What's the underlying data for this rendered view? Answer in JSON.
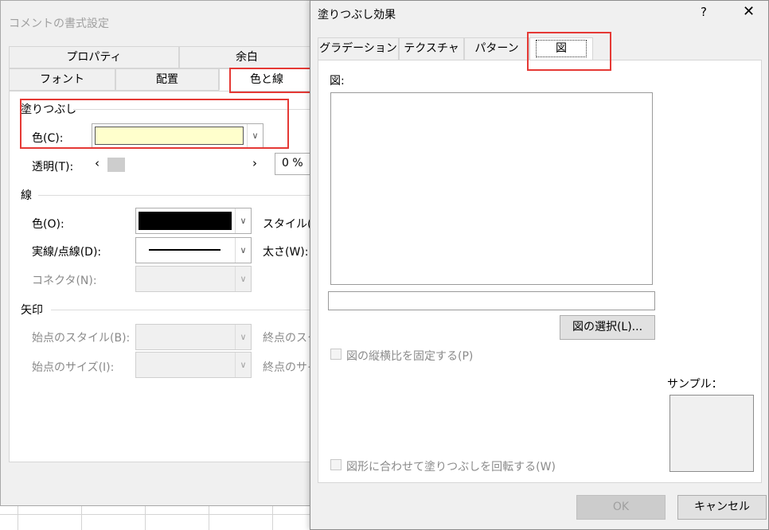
{
  "back_dialog": {
    "title": "コメントの書式設定",
    "tabs_row1": [
      "プロパティ",
      "余白"
    ],
    "tabs_row2": [
      "フォント",
      "配置",
      "色と線"
    ],
    "fill": {
      "group": "塗りつぶし",
      "color_label": "色(C):",
      "color_value": "#ffffcc",
      "transparency_label": "透明(T):",
      "transparency_value": "0 %"
    },
    "line": {
      "group": "線",
      "color_label": "色(O):",
      "color_value": "#000000",
      "style_label": "スタイル(S",
      "dash_label": "実線/点線(D):",
      "weight_label": "太さ(W):",
      "connector_label": "コネクタ(N):"
    },
    "arrows": {
      "group": "矢印",
      "start_style_label": "始点のスタイル(B):",
      "end_style_label": "終点のスタ",
      "start_size_label": "始点のサイズ(I):",
      "end_size_label": "終点のサイ"
    }
  },
  "front_dialog": {
    "title": "塗りつぶし効果",
    "help": "?",
    "close": "✕",
    "tabs": [
      "グラデーション",
      "テクスチャ",
      "パターン",
      "図"
    ],
    "active_tab": "図",
    "picture_label": "図:",
    "select_button": "図の選択(L)...",
    "lock_aspect_label": "図の縦横比を固定する(P)",
    "rotate_label": "図形に合わせて塗りつぶしを回転する(W)",
    "sample_label": "サンプル：",
    "ok": "OK",
    "cancel": "キャンセル"
  },
  "colors": {
    "highlight": "#e53935",
    "fill_swatch": "#ffffcc",
    "line_swatch": "#000000"
  }
}
